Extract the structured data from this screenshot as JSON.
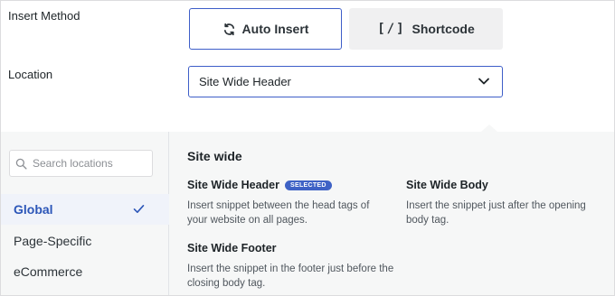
{
  "insert_method": {
    "label": "Insert Method",
    "auto_insert_label": "Auto Insert",
    "shortcode_glyph": "[/]",
    "shortcode_label": "Shortcode"
  },
  "location": {
    "label": "Location",
    "selected": "Site Wide Header"
  },
  "dropdown": {
    "search_placeholder": "Search locations",
    "categories": [
      {
        "label": "Global",
        "active": true
      },
      {
        "label": "Page-Specific",
        "active": false
      },
      {
        "label": "eCommerce",
        "active": false
      }
    ],
    "section_title": "Site wide",
    "options": [
      {
        "title": "Site Wide Header",
        "badge": "SELECTED",
        "desc": "Insert snippet between the head tags of your website on all pages."
      },
      {
        "title": "Site Wide Body",
        "badge": "",
        "desc": "Insert the snippet just after the opening body tag."
      },
      {
        "title": "Site Wide Footer",
        "badge": "",
        "desc": "Insert the snippet in the footer just before the closing body tag."
      }
    ]
  },
  "colors": {
    "accent": "#3e5ec8",
    "badge": "#3e62c5",
    "active_text": "#2c56b8",
    "panel_bg": "#f6f7f7"
  }
}
